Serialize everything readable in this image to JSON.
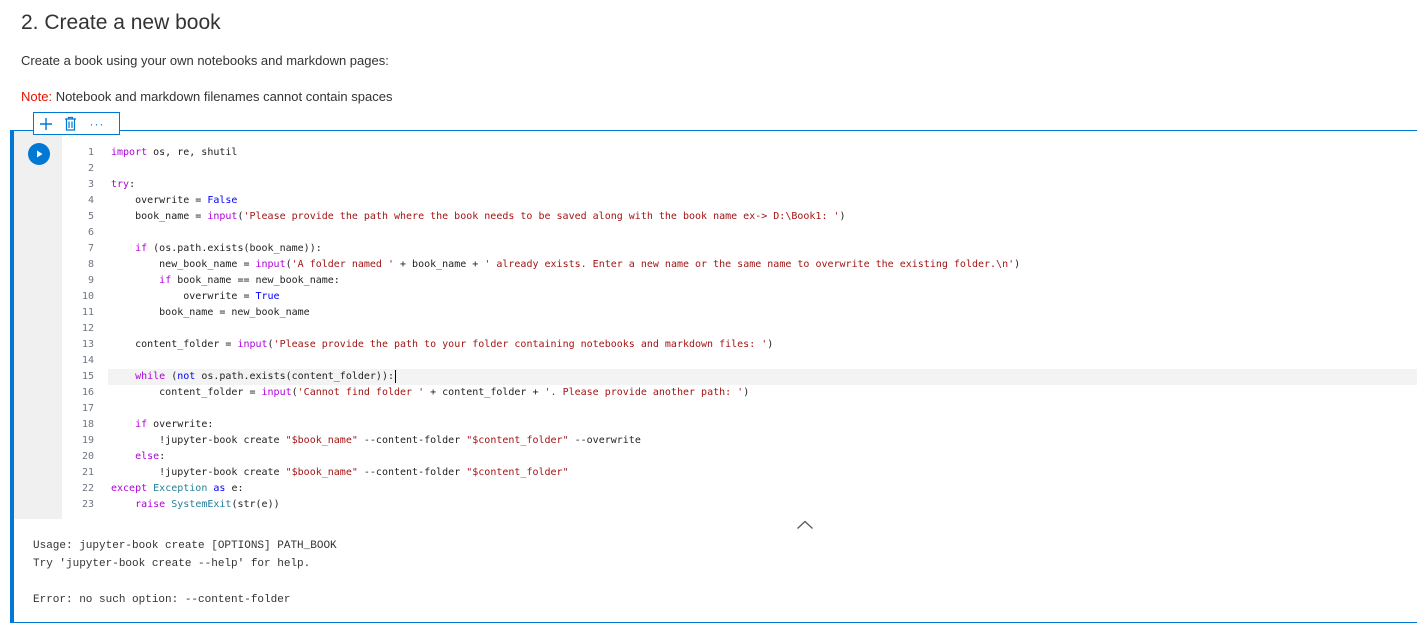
{
  "markdown": {
    "heading": "2. Create a new book",
    "paragraph": "Create a book using your own notebooks and markdown pages:",
    "note_label": "Note:",
    "note_text": " Notebook and markdown filenames cannot contain spaces"
  },
  "toolbar": {
    "add_icon": "plus-icon",
    "delete_icon": "trash-icon",
    "more_label": "···"
  },
  "code_cell": {
    "run_icon": "play-icon",
    "line_numbers": [
      "1",
      "2",
      "3",
      "4",
      "5",
      "6",
      "7",
      "8",
      "9",
      "10",
      "11",
      "12",
      "13",
      "14",
      "15",
      "16",
      "17",
      "18",
      "19",
      "20",
      "21",
      "22",
      "23"
    ],
    "lines": [
      "import os, re, shutil",
      "",
      "try:",
      "    overwrite = False",
      "    book_name = input('Please provide the path where the book needs to be saved along with the book name ex-> D:\\Book1: ')",
      "",
      "    if (os.path.exists(book_name)):",
      "        new_book_name = input('A folder named ' + book_name + ' already exists. Enter a new name or the same name to overwrite the existing folder.\\n')",
      "        if book_name == new_book_name:",
      "            overwrite = True",
      "        book_name = new_book_name",
      "",
      "    content_folder = input('Please provide the path to your folder containing notebooks and markdown files: ')",
      "",
      "    while (not os.path.exists(content_folder)):",
      "        content_folder = input('Cannot find folder ' + content_folder + '. Please provide another path: ')",
      "",
      "    if overwrite:",
      "        !jupyter-book create \"$book_name\" --content-folder \"$content_folder\" --overwrite",
      "    else:",
      "        !jupyter-book create \"$book_name\" --content-folder \"$content_folder\"",
      "except Exception as e:",
      "    raise SystemExit(str(e))"
    ],
    "collapse_icon": "chevron-up-icon"
  },
  "output": {
    "lines": [
      "Usage: jupyter-book create [OPTIONS] PATH_BOOK",
      "Try 'jupyter-book create --help' for help.",
      "",
      "Error: no such option: --content-folder"
    ]
  },
  "colors": {
    "accent": "#0078d4",
    "note": "#e51400",
    "keyword": "#0000ff",
    "control_keyword": "#af00db",
    "string": "#a31515",
    "class": "#267f99"
  }
}
